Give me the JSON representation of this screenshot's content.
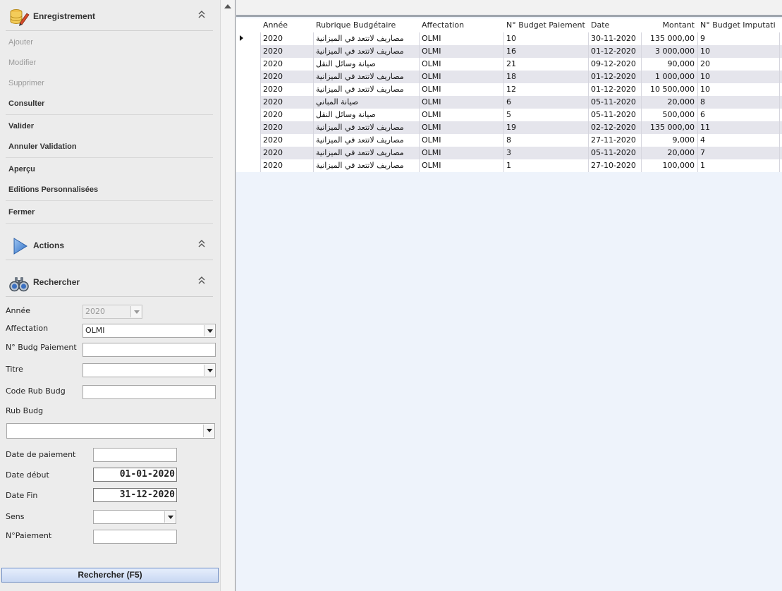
{
  "sidebar": {
    "enregistrement": {
      "title": "Enregistrement",
      "items": [
        {
          "label": "Ajouter",
          "enabled": false
        },
        {
          "label": "Modifier",
          "enabled": false
        },
        {
          "label": "Supprimer",
          "enabled": false
        },
        {
          "label": "Consulter",
          "enabled": true
        },
        {
          "label": "Valider",
          "enabled": true
        },
        {
          "label": "Annuler Validation",
          "enabled": true
        },
        {
          "label": "Aperçu",
          "enabled": true
        },
        {
          "label": "Editions Personnalisées",
          "enabled": true
        },
        {
          "label": "Fermer",
          "enabled": true
        }
      ]
    },
    "actions": {
      "title": "Actions"
    },
    "rechercher": {
      "title": "Rechercher",
      "annee": {
        "label": "Année",
        "value": "2020"
      },
      "affectation": {
        "label": "Affectation",
        "value": "OLMI"
      },
      "n_budg_paiement": {
        "label": "N° Budg Paiement",
        "value": ""
      },
      "titre": {
        "label": "Titre",
        "value": ""
      },
      "code_rub_budg": {
        "label": "Code Rub Budg",
        "value": ""
      },
      "rub_budg": {
        "label": "Rub Budg",
        "value": ""
      },
      "date_paiement": {
        "label": "Date de paiement",
        "value": ""
      },
      "date_debut": {
        "label": "Date début",
        "value": "01-01-2020"
      },
      "date_fin": {
        "label": "Date Fin",
        "value": "31-12-2020"
      },
      "sens": {
        "label": "Sens",
        "value": ""
      },
      "n_paiement": {
        "label": "N°Paiement",
        "value": ""
      },
      "button_label": "Rechercher (F5)"
    }
  },
  "grid": {
    "columns": [
      "Année",
      "Rubrique Budgétaire",
      "Affectation",
      "N° Budget Paiement",
      "Date",
      "Montant",
      "N° Budget Imputati"
    ],
    "rows": [
      [
        "2020",
        "مصاريف لاتتعد في الميزانية",
        "OLMI",
        "10",
        "30-11-2020",
        "135 000,00",
        "9"
      ],
      [
        "2020",
        "مصاريف لاتتعد في الميزانية",
        "OLMI",
        "16",
        "01-12-2020",
        "3 000,000",
        "10"
      ],
      [
        "2020",
        "صيانة وسائل النقل",
        "OLMI",
        "21",
        "09-12-2020",
        "90,000",
        "20"
      ],
      [
        "2020",
        "مصاريف لاتتعد في الميزانية",
        "OLMI",
        "18",
        "01-12-2020",
        "1 000,000",
        "10"
      ],
      [
        "2020",
        "مصاريف لاتتعد في الميزانية",
        "OLMI",
        "12",
        "01-12-2020",
        "10 500,000",
        "10"
      ],
      [
        "2020",
        "صيانة المباني",
        "OLMI",
        "6",
        "05-11-2020",
        "20,000",
        "8"
      ],
      [
        "2020",
        "صيانة وسائل النقل",
        "OLMI",
        "5",
        "05-11-2020",
        "500,000",
        "6"
      ],
      [
        "2020",
        "مصاريف لاتتعد في الميزانية",
        "OLMI",
        "19",
        "02-12-2020",
        "135 000,00",
        "11"
      ],
      [
        "2020",
        "مصاريف لاتتعد في الميزانية",
        "OLMI",
        "8",
        "27-11-2020",
        "9,000",
        "4"
      ],
      [
        "2020",
        "مصاريف لاتتعد في الميزانية",
        "OLMI",
        "3",
        "05-11-2020",
        "20,000",
        "7"
      ],
      [
        "2020",
        "مصاريف لاتتعد في الميزانية",
        "OLMI",
        "1",
        "27-10-2020",
        "100,000",
        "1"
      ]
    ],
    "selected_row": 0
  },
  "icons": {
    "enregistrement": "database-pencil-icon",
    "actions": "play-triangle-icon",
    "rechercher": "binoculars-icon",
    "collapse": "double-chevron-up-icon"
  },
  "colors": {
    "sidebar_bg": "#ececec",
    "grid_bg": "#eef3fb",
    "alt_row": "#e5e5ec",
    "button_border": "#6b8bc4"
  }
}
